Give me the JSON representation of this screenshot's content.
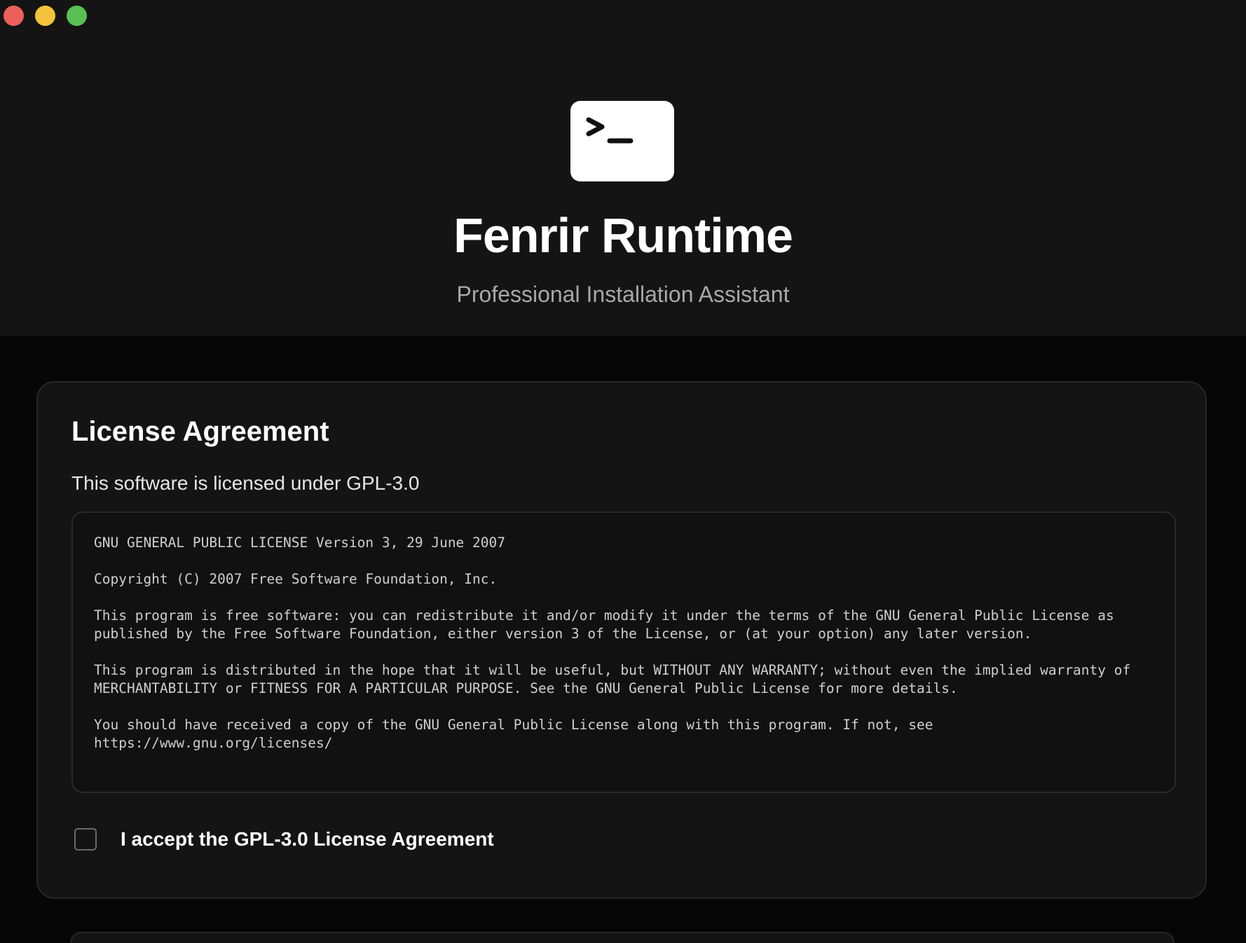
{
  "window": {
    "controls": [
      "close",
      "minimize",
      "zoom"
    ]
  },
  "app": {
    "icon": "terminal-icon",
    "title": "Fenrir Runtime",
    "subtitle": "Professional Installation Assistant"
  },
  "license": {
    "heading": "License Agreement",
    "description": "This software is licensed under GPL-3.0",
    "paragraphs": [
      "GNU GENERAL PUBLIC LICENSE Version 3, 29 June 2007",
      "Copyright (C) 2007 Free Software Foundation, Inc.",
      "This program is free software: you can redistribute it and/or modify it under the terms of the GNU General Public License as published by the Free Software Foundation, either version 3 of the License, or (at your option) any later version.",
      "This program is distributed in the hope that it will be useful, but WITHOUT ANY WARRANTY; without even the implied warranty of MERCHANTABILITY or FITNESS FOR A PARTICULAR PURPOSE. See the GNU General Public License for more details.",
      "You should have received a copy of the GNU General Public License along with this program. If not, see https://www.gnu.org/licenses/"
    ],
    "accept_label": "I accept the GPL-3.0 License Agreement",
    "accepted": false
  },
  "colors": {
    "close": "#ee5f5b",
    "minimize": "#f5c33b",
    "zoom": "#58c152"
  }
}
